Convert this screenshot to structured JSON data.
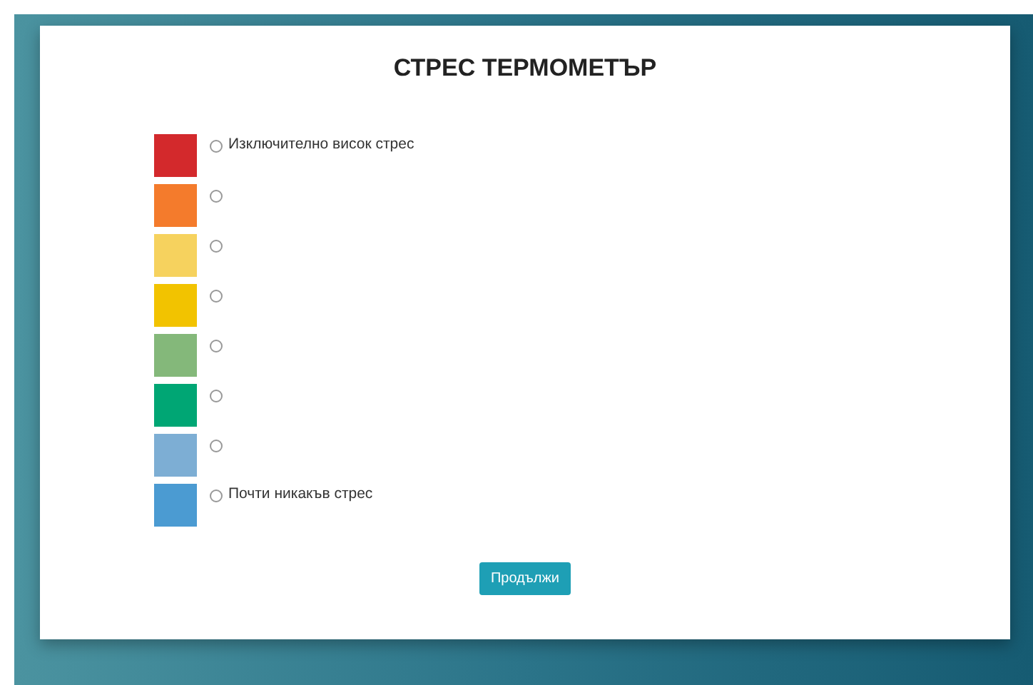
{
  "title": "СТРЕС ТЕРМОМЕТЪР",
  "levels": [
    {
      "color": "#d3292c",
      "label": "Изключително висок стрес",
      "selected": false
    },
    {
      "color": "#f47b2c",
      "selected": false
    },
    {
      "color": "#f6d25e",
      "selected": false
    },
    {
      "color": "#f2c300",
      "selected": false
    },
    {
      "color": "#84b87a",
      "selected": false
    },
    {
      "color": "#00a674",
      "selected": false
    },
    {
      "color": "#7daed4",
      "selected": false
    },
    {
      "color": "#4b9bd2",
      "label": "Почти никакъв стрес",
      "selected": false
    }
  ],
  "button": "Продължи"
}
